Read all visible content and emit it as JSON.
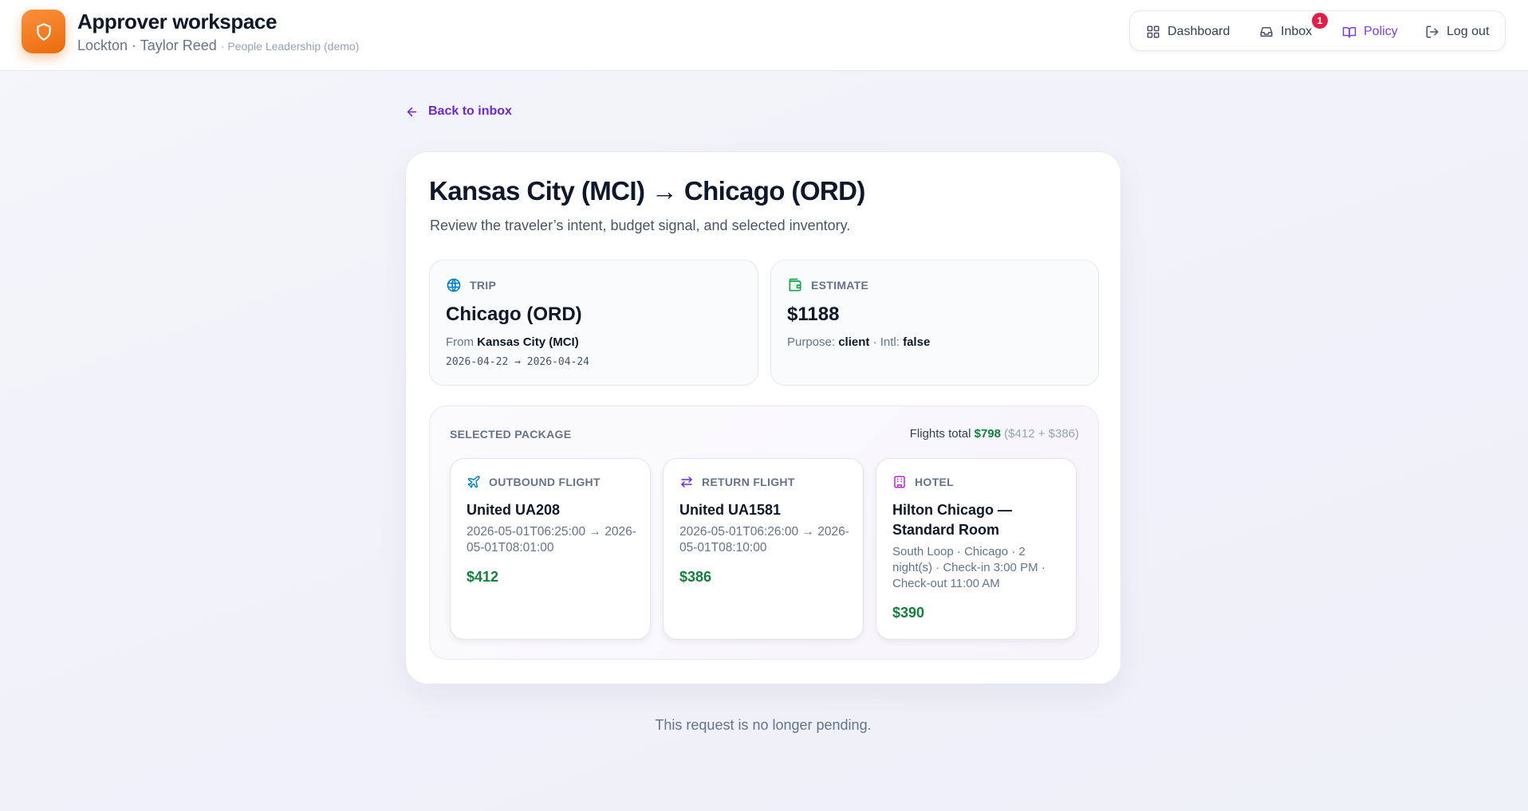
{
  "app": {
    "title": "Approver workspace",
    "user_line": "Lockton · Taylor Reed",
    "org_line": "People Leadership (demo)",
    "logo_icon": "shield-icon",
    "brand_color": "#f97316"
  },
  "nav": {
    "dashboard": "Dashboard",
    "inbox": "Inbox",
    "inbox_badge": "1",
    "policy": "Policy",
    "logout": "Log out"
  },
  "back_link": "Back to inbox",
  "request": {
    "title": "Kansas City (MCI) → Chicago (ORD)",
    "subtitle": "Review the traveler’s intent, budget signal, and selected inventory.",
    "trip": {
      "label": "TRIP",
      "destination": "Chicago (ORD)",
      "from_prefix": "From",
      "from": "Kansas City (MCI)",
      "dates": "2026-04-22 → 2026-04-24"
    },
    "estimate": {
      "label": "ESTIMATE",
      "amount": "$1188",
      "purpose_prefix": "Purpose:",
      "purpose": "client",
      "intl_prefix": "· Intl:",
      "intl": "false"
    },
    "package": {
      "label": "SELECTED PACKAGE",
      "total_prefix": "Flights total",
      "total": "$798",
      "breakdown": "($412 + $386)",
      "outbound": {
        "label": "OUTBOUND FLIGHT",
        "name": "United UA208",
        "times": "2026-05-01T06:25:00 → 2026-05-01T08:01:00",
        "price": "$412"
      },
      "return": {
        "label": "RETURN FLIGHT",
        "name": "United UA1581",
        "times": "2026-05-01T06:26:00 → 2026-05-01T08:10:00",
        "price": "$386"
      },
      "hotel": {
        "label": "HOTEL",
        "name": "Hilton Chicago — Standard Room",
        "details": "South Loop · Chicago · 2 night(s) · Check-in 3:00 PM · Check-out 11:00 AM",
        "price": "$390"
      }
    }
  },
  "status_note": "This request is no longer pending."
}
